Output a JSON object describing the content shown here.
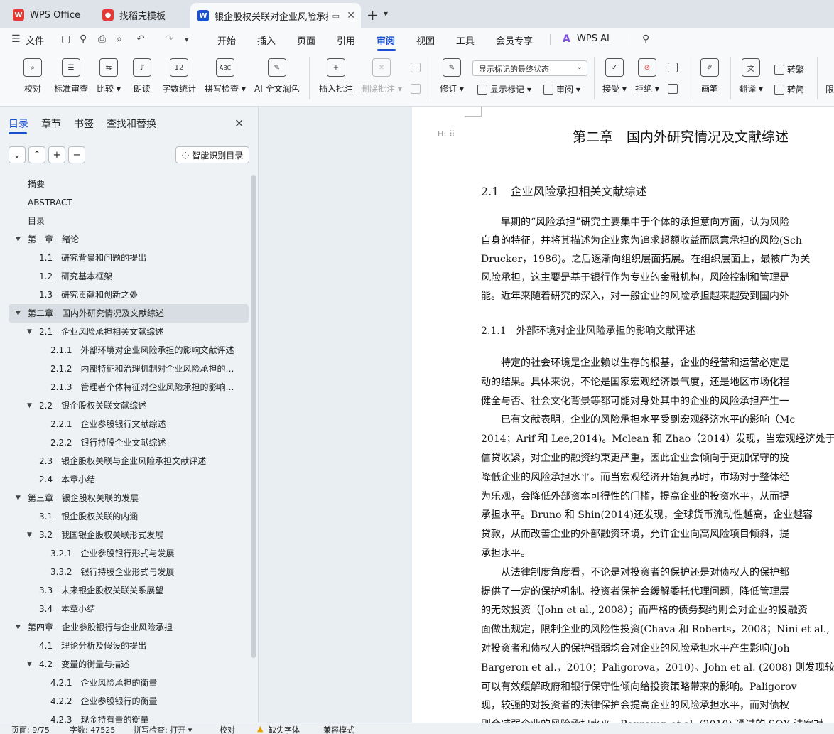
{
  "tabs": [
    {
      "label": "WPS Office",
      "color": "#e53935"
    },
    {
      "label": "找稻壳模板",
      "color": "#e53935"
    },
    {
      "label": "银企股权关联对企业风险承担…",
      "color": "#1b4fd1"
    }
  ],
  "menu": {
    "file": "文件",
    "items": [
      "开始",
      "插入",
      "页面",
      "引用",
      "审阅",
      "视图",
      "工具",
      "会员专享"
    ],
    "active": "审阅",
    "ai": "WPS AI"
  },
  "ribbon": {
    "buttons": [
      {
        "label": "校对",
        "icon": "proofread-icon"
      },
      {
        "label": "标准审查",
        "icon": "standard-review-icon"
      },
      {
        "label": "比较 ▾",
        "icon": "compare-icon"
      },
      {
        "label": "朗读",
        "icon": "read-aloud-icon"
      },
      {
        "label": "字数统计",
        "icon": "word-count-icon",
        "glyph": "12"
      },
      {
        "label": "拼写检查 ▾",
        "icon": "spell-check-icon",
        "glyph": "ABC"
      },
      {
        "label": "AI 全文润色",
        "icon": "ai-polish-icon"
      },
      {
        "label": "插入批注",
        "icon": "insert-comment-icon"
      },
      {
        "label": "删除批注 ▾",
        "icon": "delete-comment-icon"
      },
      {
        "label": "修订 ▾",
        "icon": "revision-icon"
      },
      {
        "label": "接受 ▾",
        "icon": "accept-icon"
      },
      {
        "label": "拒绝 ▾",
        "icon": "reject-icon"
      },
      {
        "label": "画笔",
        "icon": "pen-icon"
      },
      {
        "label": "翻译 ▾",
        "icon": "translate-icon"
      }
    ],
    "markup_dropdown": "显示标记的最终状态",
    "show_markup": "显示标记 ▾",
    "review": "审阅 ▾",
    "to_traditional": "转繁",
    "to_simplified": "转简",
    "cut_off": "限"
  },
  "sidebar": {
    "tabs": [
      "目录",
      "章节",
      "书签",
      "查找和替换"
    ],
    "smart_button": "智能识别目录",
    "toc": [
      {
        "label": "摘要",
        "level": 0,
        "tw": false
      },
      {
        "label": "ABSTRACT",
        "level": 0,
        "tw": false
      },
      {
        "label": "目录",
        "level": 0,
        "tw": false
      },
      {
        "label": "第一章　绪论",
        "level": 0,
        "tw": true
      },
      {
        "label": "1.1　研究背景和问题的提出",
        "level": 1,
        "tw": false
      },
      {
        "label": "1.2　研究基本框架",
        "level": 1,
        "tw": false
      },
      {
        "label": "1.3　研究贡献和创新之处",
        "level": 1,
        "tw": false
      },
      {
        "label": "第二章　国内外研究情况及文献综述",
        "level": 0,
        "tw": true,
        "sel": true
      },
      {
        "label": "2.1　企业风险承担相关文献综述",
        "level": 1,
        "tw": true
      },
      {
        "label": "2.1.1　外部环境对企业风险承担的影响文献评述",
        "level": 2,
        "tw": false
      },
      {
        "label": "2.1.2　内部特征和治理机制对企业风险承担的影…",
        "level": 2,
        "tw": false
      },
      {
        "label": "2.1.3　管理者个体特征对企业风险承担的影响文…",
        "level": 2,
        "tw": false
      },
      {
        "label": "2.2　银企股权关联文献综述",
        "level": 1,
        "tw": true
      },
      {
        "label": "2.2.1　企业参股银行文献综述",
        "level": 2,
        "tw": false
      },
      {
        "label": "2.2.2　银行持股企业文献综述",
        "level": 2,
        "tw": false
      },
      {
        "label": "2.3　银企股权关联与企业风险承担文献评述",
        "level": 1,
        "tw": false
      },
      {
        "label": "2.4　本章小结",
        "level": 1,
        "tw": false
      },
      {
        "label": "第三章　银企股权关联的发展",
        "level": 0,
        "tw": true
      },
      {
        "label": "3.1　银企股权关联的内涵",
        "level": 1,
        "tw": false
      },
      {
        "label": "3.2　我国银企股权关联形式发展",
        "level": 1,
        "tw": true
      },
      {
        "label": "3.2.1　企业参股银行形式与发展",
        "level": 2,
        "tw": false
      },
      {
        "label": "3.3.2　银行持股企业形式与发展",
        "level": 2,
        "tw": false
      },
      {
        "label": "3.3　未来银企股权关联关系展望",
        "level": 1,
        "tw": false
      },
      {
        "label": "3.4　本章小结",
        "level": 1,
        "tw": false
      },
      {
        "label": "第四章　企业参股银行与企业风险承担",
        "level": 0,
        "tw": true
      },
      {
        "label": "4.1　理论分析及假设的提出",
        "level": 1,
        "tw": false
      },
      {
        "label": "4.2　变量的衡量与描述",
        "level": 1,
        "tw": true
      },
      {
        "label": "4.2.1　企业风险承担的衡量",
        "level": 2,
        "tw": false
      },
      {
        "label": "4.2.2　企业参股银行的衡量",
        "level": 2,
        "tw": false
      },
      {
        "label": "4.2.3　现金持有量的衡量",
        "level": 2,
        "tw": false
      }
    ]
  },
  "document": {
    "heading_marker": "H₁",
    "chapter_title": "第二章　国内外研究情况及文献综述",
    "section_title": "2.1　企业风险承担相关文献综述",
    "subsection_title": "2.1.1　外部环境对企业风险承担的影响文献评述",
    "para1": [
      "　　早期的“风险承担”研究主要集中于个体的承担意向方面，认为风险",
      "自身的特征，并将其描述为企业家为追求超额收益而愿意承担的风险(Sch",
      "Drucker，1986)。之后逐渐向组织层面拓展。在组织层面上，最被广为关",
      "风险承担，这主要是基于银行作为专业的金融机构，风险控制和管理是",
      "能。近年来随着研究的深入，对一般企业的风险承担越来越受到国内外"
    ],
    "para2": [
      "　　特定的社会环境是企业赖以生存的根基，企业的经营和运营必定是",
      "动的结果。具体来说，不论是国家宏观经济景气度，还是地区市场化程",
      "健全与否、社会文化背景等都可能对身处其中的企业的风险承担产生一",
      "　　已有文献表明，企业的风险承担水平受到宏观经济水平的影响（Mc",
      "2014；Arif 和 Lee,2014)。Mclean 和 Zhao（2014）发现，当宏观经济处于",
      "信贷收紧，对企业的融资约束更严重，因此企业会倾向于更加保守的投",
      "降低企业的风险承担水平。而当宏观经济开始复苏时，市场对于整体经",
      "为乐观，会降低外部资本可得性的门槛，提高企业的投资水平，从而提",
      "承担水平。Bruno 和 Shin(2014)还发现，全球货币流动性越高，企业越容",
      "贷款，从而改善企业的外部融资环境，允许企业向高风险项目倾斜，提",
      "承担水平。",
      "　　从法律制度角度看，不论是对投资者的保护还是对债权人的保护都",
      "提供了一定的保护机制。投资者保护会缓解委托代理问题，降低管理层",
      "的无效投资（John et al., 2008）；而严格的债务契约则会对企业的投融资",
      "面做出规定，限制企业的风险性投资(Chava 和 Roberts，2008；Nini et al.,",
      "对投资者和债权人的保护强弱均会对企业的风险承担水平产生影响(Joh",
      "Bargeron et al.，2010；Paligorova，2010)。John et al. (2008) 则发现较好",
      "可以有效缓解政府和银行保守性倾向给投资策略带来的影响。Paligorov",
      "现，较强的对投资者的法律保护会提高企业的风险承担水平，而对债权",
      "则会减弱企业的风险承担水平。Bargeron et al. (2010) 通过的 SOX 法案对"
    ]
  },
  "status": {
    "page": "页面: 9/75",
    "words": "字数: 47525",
    "spell": "拼写检查: 打开 ▾",
    "proof": "校对",
    "missing_font": "缺失字体",
    "compat": "兼容模式"
  }
}
